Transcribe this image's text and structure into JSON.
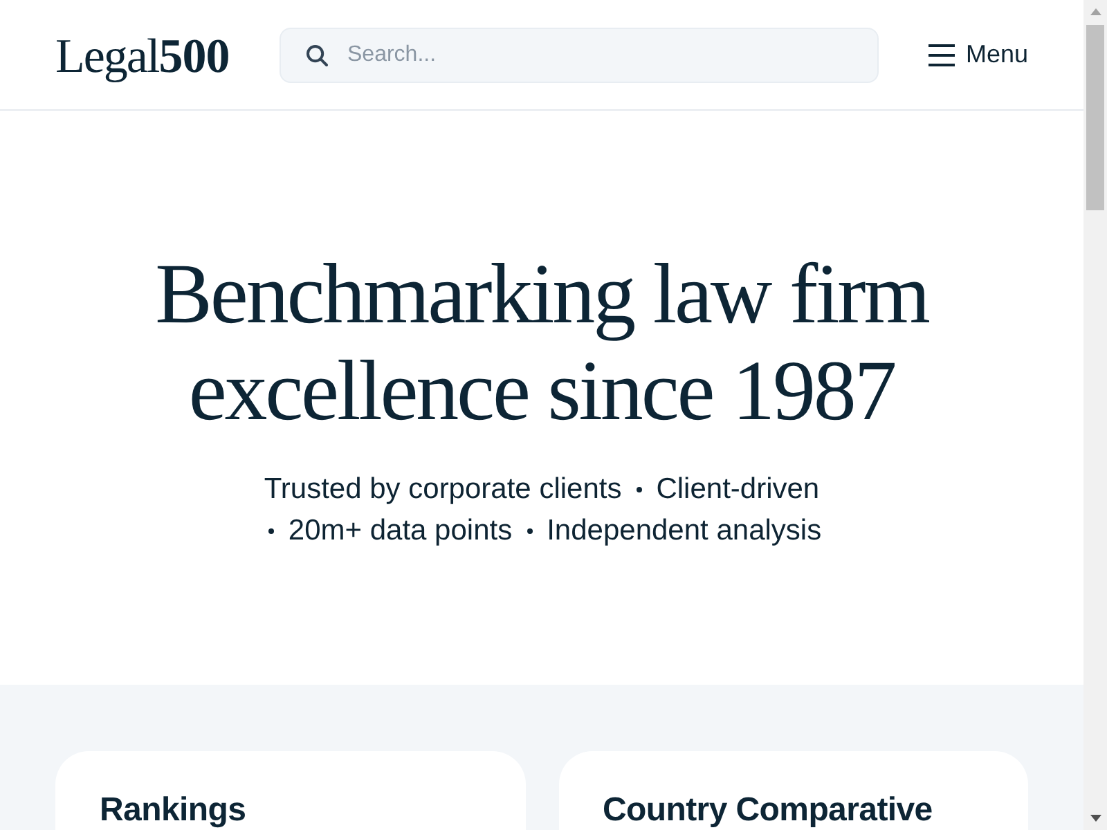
{
  "header": {
    "logo": "Legal**500**",
    "search": {
      "placeholder": "Search..."
    },
    "menu_button": "Menu"
  },
  "hero": {
    "title": "Benchmarking law firm excellence since 1987",
    "tagline": [
      "Trusted by corporate clients",
      "Client-driven",
      "20m+ data points",
      "Independent analysis"
    ]
  },
  "cards": [
    {
      "title": "Rankings"
    },
    {
      "title": "Country Comparative"
    }
  ]
}
